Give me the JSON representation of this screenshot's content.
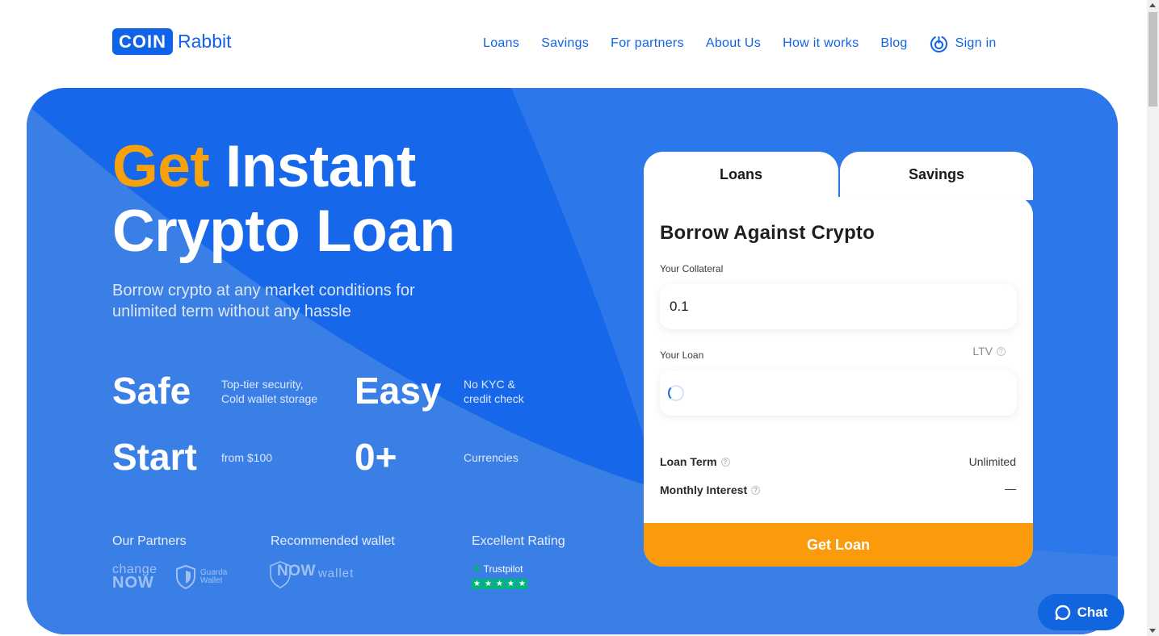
{
  "header": {
    "logo_box": "COIN",
    "logo_text": "Rabbit",
    "nav": [
      "Loans",
      "Savings",
      "For partners",
      "About Us",
      "How it works",
      "Blog"
    ],
    "sign_in": "Sign in"
  },
  "hero": {
    "headline_accent": "Get",
    "headline_rest": "Instant",
    "headline_line2": "Crypto Loan",
    "subhead": "Borrow crypto at any market conditions for unlimited term without any hassle",
    "stats": [
      {
        "big": "Safe",
        "small": [
          "Top-tier security,",
          "Cold wallet storage"
        ]
      },
      {
        "big": "Easy",
        "small": [
          "No KYC &",
          "credit check"
        ]
      },
      {
        "big": "Start",
        "small": [
          "from $100"
        ]
      },
      {
        "big": "0+",
        "small": [
          "Currencies"
        ]
      }
    ],
    "partners_label": "Our Partners",
    "wallet_label": "Recommended wallet",
    "rating_label": "Excellent Rating",
    "changenow_top": "change",
    "changenow_bottom": "NOW",
    "guarda_line1": "Guarda",
    "guarda_line2": "Wallet",
    "nowwallet_now": "NOW",
    "nowwallet_wallet": "wallet",
    "trustpilot": "Trustpilot"
  },
  "calculator": {
    "tabs": [
      "Loans",
      "Savings"
    ],
    "title": "Borrow Against Crypto",
    "collateral_label": "Your Collateral",
    "collateral_value": "0.1",
    "loan_label": "Your Loan",
    "ltv_label": "LTV",
    "loan_term_label": "Loan Term",
    "loan_term_value": "Unlimited",
    "monthly_interest_label": "Monthly Interest",
    "monthly_interest_value": "—",
    "cta": "Get Loan"
  },
  "chat": {
    "label": "Chat"
  },
  "colors": {
    "brand_blue": "#0f63e8",
    "accent_orange": "#f7a10c",
    "cta_orange": "#fb9a0a",
    "trustpilot_green": "#00b67a"
  }
}
